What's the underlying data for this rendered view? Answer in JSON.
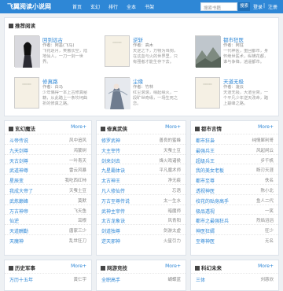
{
  "site": {
    "logo": "飞翼阅读小说网"
  },
  "nav": [
    "首页",
    "玄幻",
    "排行",
    "全本",
    "书架"
  ],
  "search": {
    "placeholder": "搜索书籍",
    "button": "搜索"
  },
  "user": {
    "login": "登录",
    "sep": "|",
    "register": "注册"
  },
  "featured": {
    "title": "推荐阅读",
    "books": [
      {
        "title": "回到远古",
        "author": "作者：阿墨(飞马)",
        "desc": "飞花逐月，笑傲长空，陆地仙人，一刀一剑一世界。"
      },
      {
        "title": "逆斩",
        "author": "作者：高木",
        "desc": "天逆之下，万物为刍狗，在这血与火的世界里，只有强者才能生存下去。"
      },
      {
        "title": "都市狂医",
        "author": "作者：阿狂",
        "desc": "一代神医，重回都市，身怀绝世医术，纵横花都，谁与争锋，逍遥都市。"
      },
      {
        "title": "修真路",
        "author": "作者：白马",
        "desc": "少年偶得一本上古修真秘籍，从此踏上一条坎坷曲折的修真之路。"
      },
      {
        "title": "尘缘",
        "author": "作者：竹林",
        "desc": "红尘滚滚，缘起缘灭，一段旷世奇缘，一场生死之恋。"
      },
      {
        "title": "天道无极",
        "author": "作者：凌云",
        "desc": "天道无极，大道至简，一个平凡少年逆天改命，踏上巅峰之路。"
      }
    ]
  },
  "sections": [
    {
      "title": "玄幻魔法",
      "more": "More+",
      "items": [
        {
          "t": "斗帝传说",
          "a": "风中追风"
        },
        {
          "t": "九天剑尊",
          "a": "鸿蒙树"
        },
        {
          "t": "天古剑尊",
          "a": "一叶青天"
        },
        {
          "t": "武道神尊",
          "a": "雷云风暴"
        },
        {
          "t": "星辰变",
          "a": "我吃西红柿"
        },
        {
          "t": "我成大帝了",
          "a": "天蚕土豆"
        },
        {
          "t": "武炼巅峰",
          "a": "莫默"
        },
        {
          "t": "万古神帝",
          "a": "飞天鱼"
        },
        {
          "t": "仙逆",
          "a": "耳根"
        },
        {
          "t": "天道酬勤",
          "a": "唐家三少"
        },
        {
          "t": "天魔神",
          "a": "乱世狂刀"
        }
      ]
    },
    {
      "title": "修真武侠",
      "more": "More+",
      "items": [
        {
          "t": "修罗武神",
          "a": "善良的蜜蜂"
        },
        {
          "t": "大主宰传",
          "a": "天蚕土豆"
        },
        {
          "t": "剑来剑去",
          "a": "烽火戏诸侯"
        },
        {
          "t": "九星霸体诀",
          "a": "平凡魔术师"
        },
        {
          "t": "太古神王",
          "a": "净无痕"
        },
        {
          "t": "凡人修仙传",
          "a": "忘语"
        },
        {
          "t": "万古至尊传说",
          "a": "太一生水"
        },
        {
          "t": "武神主宰传",
          "a": "暗魔师"
        },
        {
          "t": "太古龙象诀",
          "a": "风青阳"
        },
        {
          "t": "剑道独尊",
          "a": "剑游太虚"
        },
        {
          "t": "逆天邪神",
          "a": "火星引力"
        }
      ]
    },
    {
      "title": "都市言情",
      "more": "More+",
      "items": [
        {
          "t": "都市狂枭",
          "a": "纯情犀利哥"
        },
        {
          "t": "最强兵王",
          "a": "风起闲云"
        },
        {
          "t": "超级兵王",
          "a": "步千帆"
        },
        {
          "t": "我的美女老板",
          "a": "断刃天涯"
        },
        {
          "t": "都市至尊",
          "a": "佚名"
        },
        {
          "t": "透视神医",
          "a": "陈小北"
        },
        {
          "t": "校花的贴身高手",
          "a": "鱼人二代"
        },
        {
          "t": "极品透视",
          "a": "一笑"
        },
        {
          "t": "都市之最强狂兵",
          "a": "烈焰滔滔"
        },
        {
          "t": "神医狂婿",
          "a": "狂少"
        },
        {
          "t": "至尊神医",
          "a": "无名"
        }
      ]
    }
  ],
  "bottom_sections": [
    {
      "title": "历史军事",
      "more": "More+",
      "items": [
        {
          "t": "万历十五年",
          "a": "黄仁宇"
        }
      ]
    },
    {
      "title": "网游竞技",
      "more": "More+",
      "items": [
        {
          "t": "全职高手",
          "a": "蝴蝶蓝"
        }
      ]
    },
    {
      "title": "科幻未来",
      "more": "More+",
      "items": [
        {
          "t": "三体",
          "a": "刘慈欣"
        }
      ]
    }
  ]
}
